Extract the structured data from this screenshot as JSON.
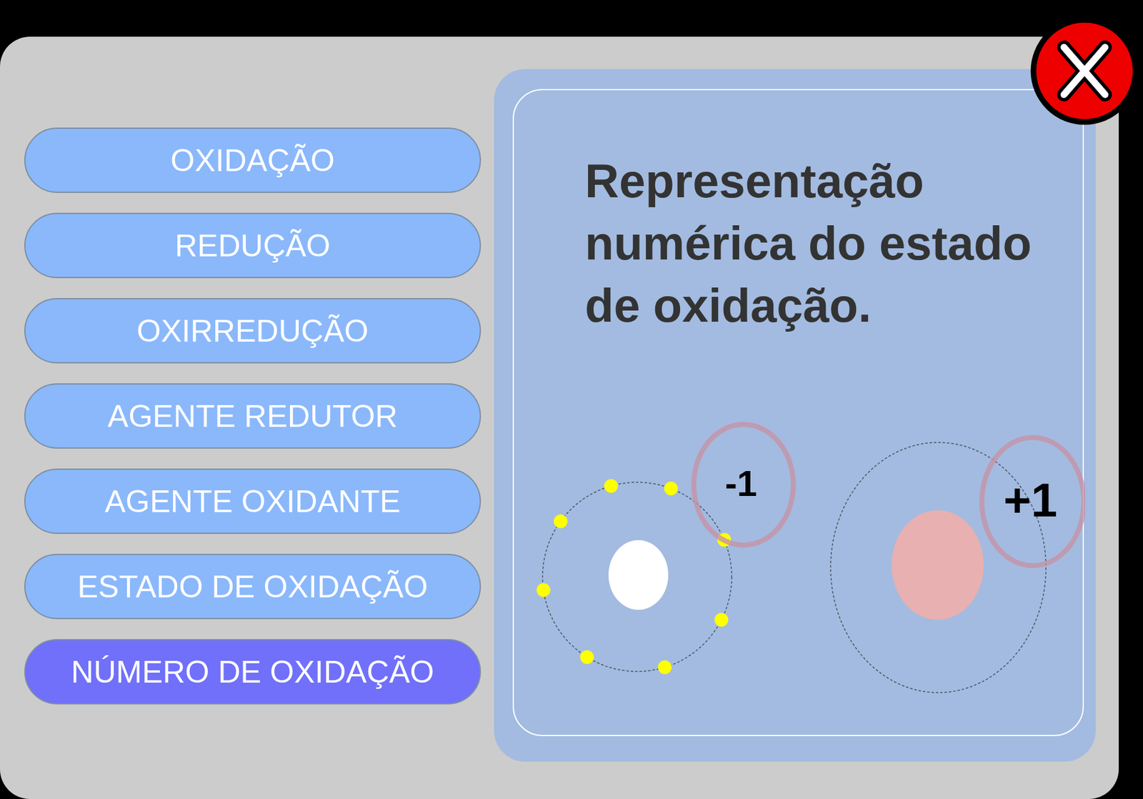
{
  "menu": {
    "items": [
      {
        "label": "OXIDAÇÃO",
        "selected": false
      },
      {
        "label": "REDUÇÃO",
        "selected": false
      },
      {
        "label": "OXIRREDUÇÃO",
        "selected": false
      },
      {
        "label": "AGENTE REDUTOR",
        "selected": false
      },
      {
        "label": "AGENTE OXIDANTE",
        "selected": false
      },
      {
        "label": "ESTADO DE OXIDAÇÃO",
        "selected": false
      },
      {
        "label": "NÚMERO DE OXIDAÇÃO",
        "selected": true
      }
    ]
  },
  "panel": {
    "description": "Representação numérica do estado de oxidação."
  },
  "atoms": [
    {
      "charge": "-1",
      "electrons": 8
    },
    {
      "charge": "+1",
      "electrons": 0
    }
  ]
}
